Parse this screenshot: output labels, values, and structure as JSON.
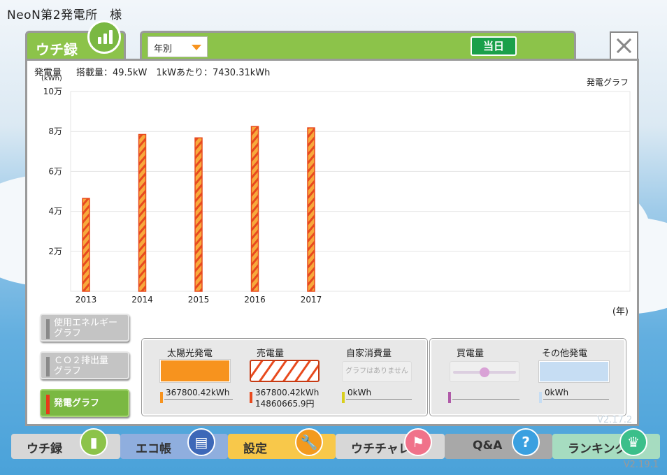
{
  "window": {
    "owner_title": "NeoN第2発電所　様",
    "tab_label": "ウチ録",
    "period_select": "年別",
    "today_button": "当日",
    "version": "V2.19.1",
    "ghost_version": "V2.17.2"
  },
  "header": {
    "unit_label": "発電量",
    "unit_sub": "(kWh)",
    "capacity_text": "搭載量：49.5kW　1kWあたり：7430.31kWh",
    "graph_title": "発電グラフ",
    "year_unit": "(年)"
  },
  "side_buttons": [
    {
      "label": "使用エネルギー\nグラフ",
      "active": false
    },
    {
      "label": "ＣＯ２排出量\nグラフ",
      "active": false
    },
    {
      "label": "発電グラフ",
      "active": true
    }
  ],
  "legend": {
    "solar": {
      "title": "太陽光発電",
      "value": "367800.42kWh",
      "color": "#f7931e"
    },
    "sold": {
      "title": "売電量",
      "value": "367800.42kWh",
      "value2": "14860665.9円",
      "color": "#e84a1e"
    },
    "self": {
      "title": "自家消費量",
      "placeholder": "グラフはありません",
      "value": "0kWh",
      "color": "#d9cf1e"
    },
    "bought": {
      "title": "買電量",
      "value": "",
      "color": "#b05aa8"
    },
    "other": {
      "title": "その他発電",
      "value": "0kWh",
      "color": "#c6ddf3"
    }
  },
  "nav": [
    {
      "label": "ウチ録",
      "icon": "bar-chart-icon",
      "bg": "#d7d7d7",
      "iconbg": "#8cc34a"
    },
    {
      "label": "エコ帳",
      "icon": "notebook-icon",
      "bg": "#8faede",
      "iconbg": "#3d68b8"
    },
    {
      "label": "設定",
      "icon": "wrench-icon",
      "bg": "#f8c84a",
      "iconbg": "#f39a1e"
    },
    {
      "label": "ウチチャレ",
      "icon": "flag-icon",
      "bg": "#d7d7d7",
      "iconbg": "#f0728a"
    },
    {
      "label": "Q&A",
      "icon": "question-icon",
      "bg": "#a8a8a8",
      "iconbg": "#3aa0e0"
    },
    {
      "label": "ランキング",
      "icon": "crown-icon",
      "bg": "#a6dcc0",
      "iconbg": "#3bbf8a"
    }
  ],
  "chart_data": {
    "type": "bar",
    "categories": [
      "2013",
      "2014",
      "2015",
      "2016",
      "2017"
    ],
    "values": [
      46500,
      78500,
      76800,
      82500,
      81800
    ],
    "ylim": [
      0,
      100000
    ],
    "yticks": [
      {
        "value": 20000,
        "label": "2万"
      },
      {
        "value": 40000,
        "label": "4万"
      },
      {
        "value": 60000,
        "label": "6万"
      },
      {
        "value": 80000,
        "label": "8万"
      },
      {
        "value": 100000,
        "label": "10万"
      }
    ],
    "bar_fill": "#f7a93c",
    "bar_stripe": "#e84a1e",
    "grid": true
  }
}
